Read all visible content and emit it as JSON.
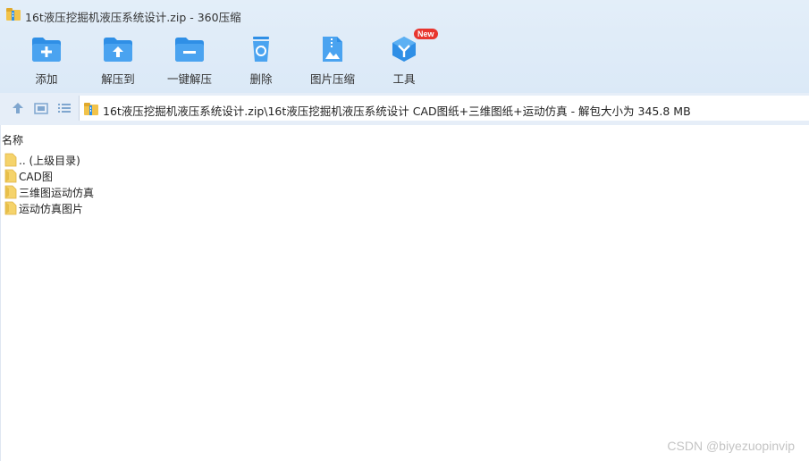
{
  "window": {
    "title": "16t液压挖掘机液压系统设计.zip - 360压缩"
  },
  "toolbar": {
    "items": [
      {
        "label": "添加",
        "icon": "folder-add-icon"
      },
      {
        "label": "解压到",
        "icon": "folder-extract-icon"
      },
      {
        "label": "一键解压",
        "icon": "folder-oneclick-extract-icon"
      },
      {
        "label": "删除",
        "icon": "trash-icon"
      },
      {
        "label": "图片压缩",
        "icon": "image-compress-icon"
      },
      {
        "label": "工具",
        "icon": "tools-cube-icon",
        "badge": "New"
      }
    ]
  },
  "address_bar": {
    "path": "16t液压挖掘机液压系统设计.zip\\16t液压挖掘机液压系统设计 CAD图纸+三维图纸+运动仿真 - 解包大小为 345.8 MB"
  },
  "file_list": {
    "column_name": "名称",
    "rows": [
      {
        "name": ".. (上级目录)"
      },
      {
        "name": "CAD图"
      },
      {
        "name": "三维图运动仿真"
      },
      {
        "name": "运动仿真图片"
      }
    ]
  },
  "watermark": "CSDN @biyezuopinvip",
  "colors": {
    "accent_blue": "#2f8fe6",
    "folder_yellow": "#f5d36b",
    "badge_red": "#e8352e"
  }
}
